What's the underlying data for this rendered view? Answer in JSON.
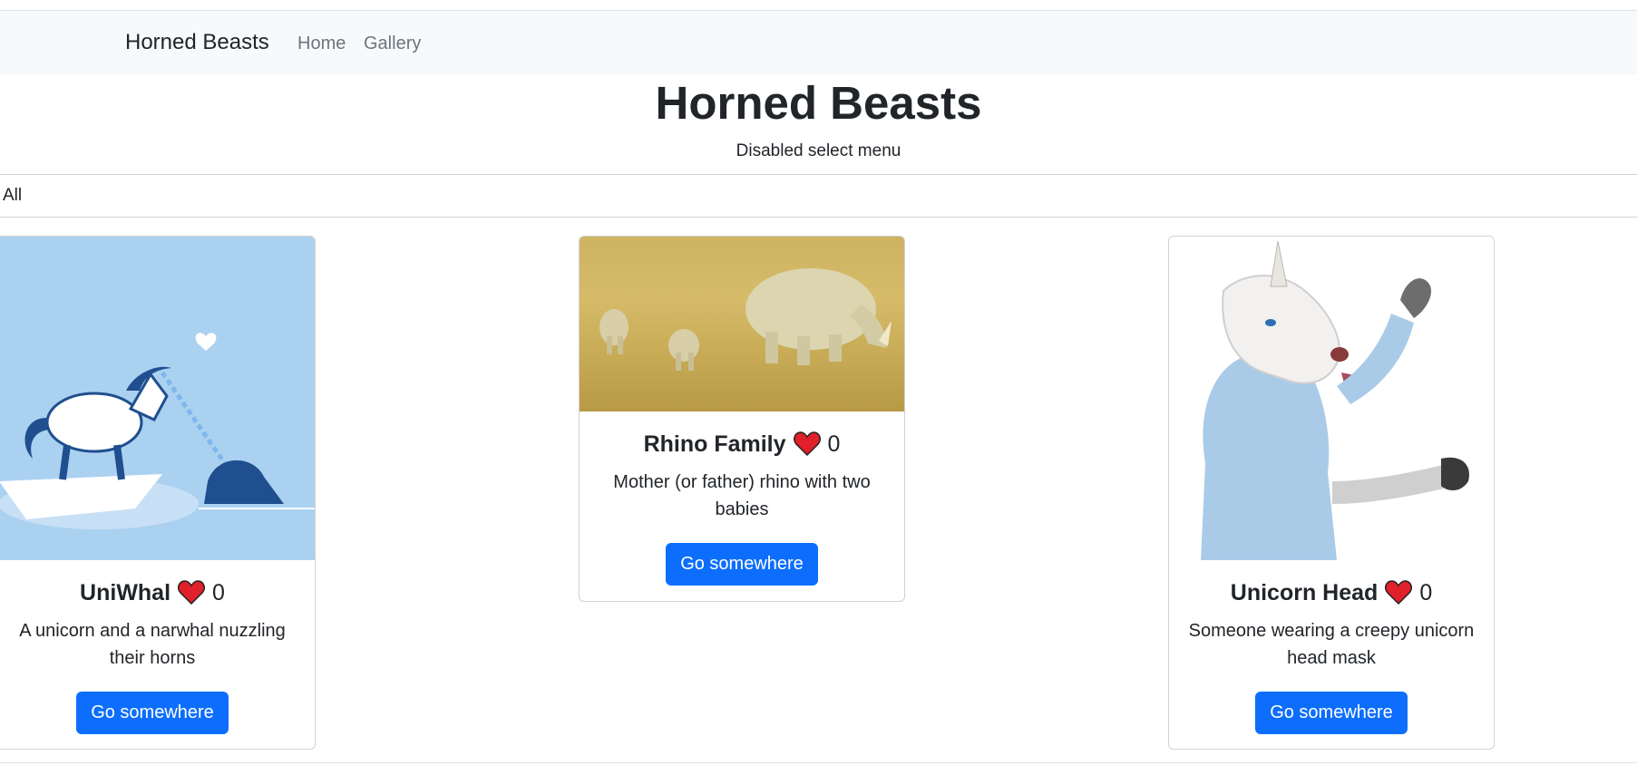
{
  "navbar": {
    "brand": "Horned Beasts",
    "links": [
      "Home",
      "Gallery"
    ]
  },
  "header": {
    "title": "Horned Beasts",
    "select_label": "Disabled select menu",
    "select_value": "All"
  },
  "cards": [
    {
      "title": "UniWhal",
      "likes": "0",
      "description": "A unicorn and a narwhal nuzzling their horns",
      "button": "Go somewhere"
    },
    {
      "title": "Rhino Family",
      "likes": "0",
      "description": "Mother (or father) rhino with two babies",
      "button": "Go somewhere"
    },
    {
      "title": "Unicorn Head",
      "likes": "0",
      "description": "Someone wearing a creepy unicorn head mask",
      "button": "Go somewhere"
    }
  ],
  "colors": {
    "primary": "#0d6efd",
    "navbar_bg": "#f8f9fa",
    "heart": "#e0202a"
  },
  "icons": {
    "heart": "heart-icon"
  }
}
